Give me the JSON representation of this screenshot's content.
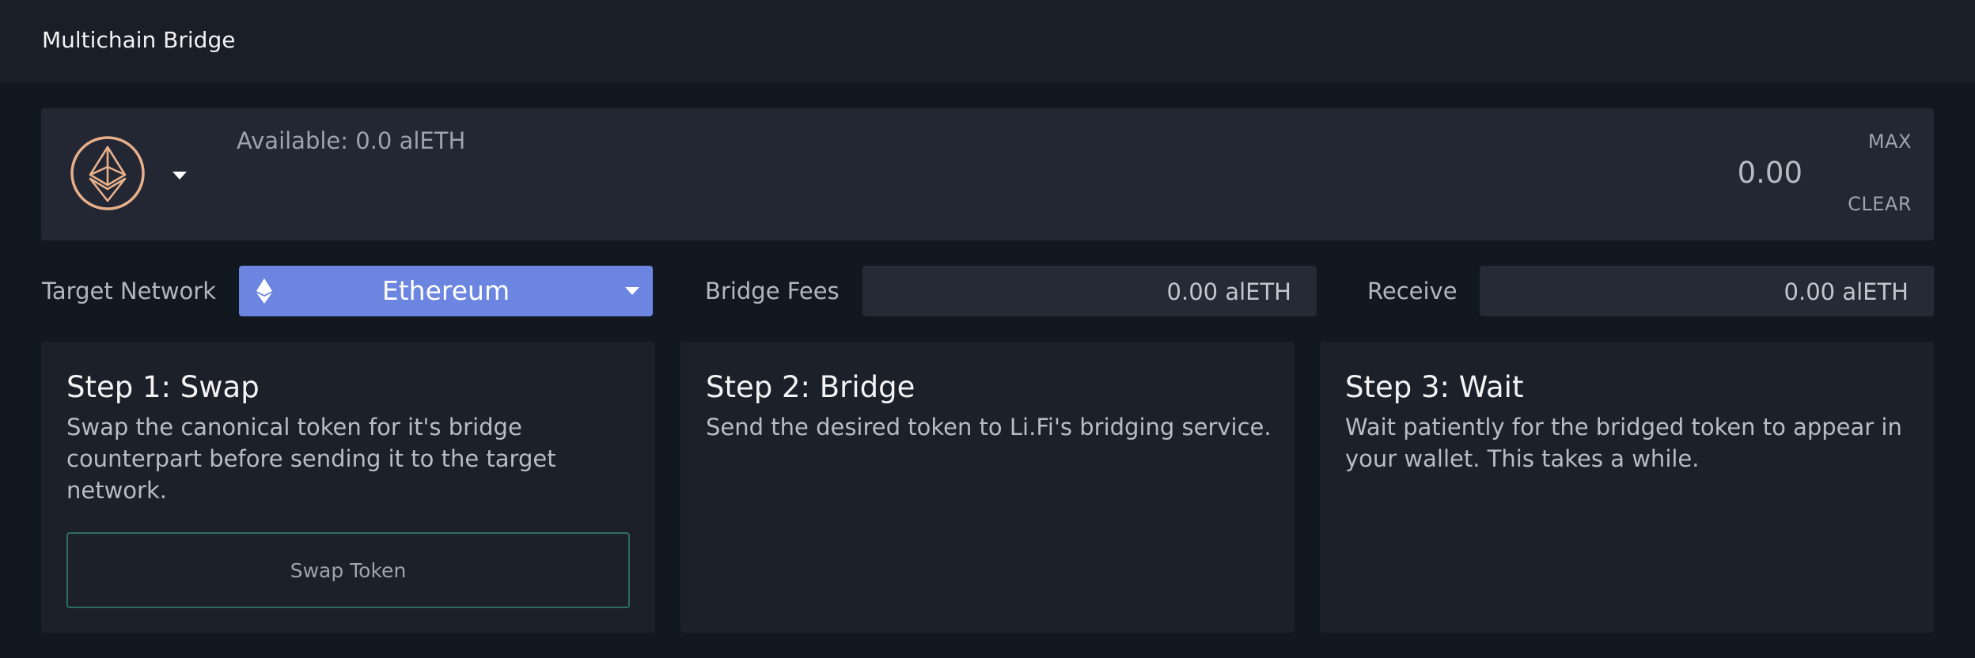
{
  "header": {
    "title": "Multichain Bridge"
  },
  "token_panel": {
    "token_icon": "ethereum-circle-icon",
    "available": "Available: 0.0 alETH",
    "amount": "0.00",
    "max_label": "MAX",
    "clear_label": "CLEAR"
  },
  "network_row": {
    "target_label": "Target Network",
    "selected_network": "Ethereum",
    "network_icon": "ethereum-icon",
    "fees_label": "Bridge Fees",
    "fees_value": "0.00 alETH",
    "receive_label": "Receive",
    "receive_value": "0.00 alETH"
  },
  "steps": [
    {
      "title": "Step 1: Swap",
      "text": "Swap the canonical token for it's bridge counterpart before sending it to the target network.",
      "button_label": "Swap Token"
    },
    {
      "title": "Step 2: Bridge",
      "text": "Send the desired token to Li.Fi's bridging service."
    },
    {
      "title": "Step 3: Wait",
      "text": "Wait patiently for the bridged token to appear in your wallet. This takes a while."
    }
  ],
  "colors": {
    "accent": "#6b85e0",
    "token_icon": "#e8b08a",
    "swap_border": "#2e6d62"
  }
}
